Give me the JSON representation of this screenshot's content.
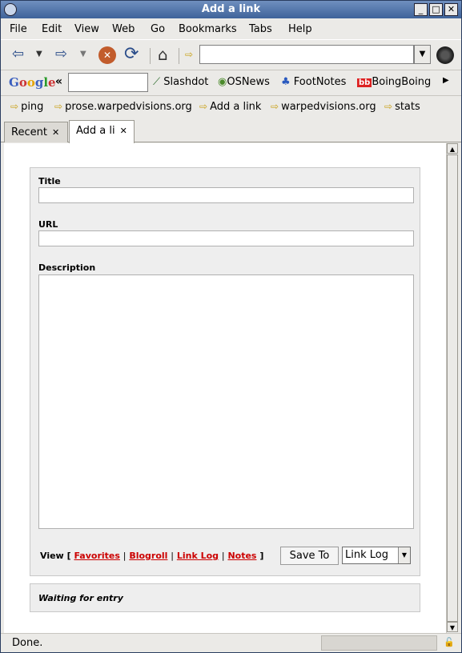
{
  "window": {
    "title": "Add a link"
  },
  "menu": [
    {
      "label": "File"
    },
    {
      "label": "Edit"
    },
    {
      "label": "View"
    },
    {
      "label": "Web"
    },
    {
      "label": "Go"
    },
    {
      "label": "Bookmarks"
    },
    {
      "label": "Tabs"
    },
    {
      "label": "Help"
    }
  ],
  "toolbar": {
    "url_value": ""
  },
  "search_bar": {
    "logo": "Google",
    "chevron": "«",
    "query": "",
    "bookmarks": [
      {
        "label": "Slashdot",
        "icon": "slashdot-icon"
      },
      {
        "label": "OSNews",
        "icon": "osnews-icon"
      },
      {
        "label": "FootNotes",
        "icon": "footnotes-icon"
      },
      {
        "label": "BoingBoing",
        "icon": "boingboing-icon",
        "badge": "bb"
      }
    ]
  },
  "bookmarks_bar": [
    {
      "label": "ping"
    },
    {
      "label": "prose.warpedvisions.org"
    },
    {
      "label": "Add a link"
    },
    {
      "label": "warpedvisions.org"
    },
    {
      "label": "stats"
    }
  ],
  "tabs": [
    {
      "label": "Recent",
      "active": false
    },
    {
      "label": "Add a li",
      "active": true
    }
  ],
  "form": {
    "title_label": "Title",
    "title_value": "",
    "url_label": "URL",
    "url_value": "",
    "description_label": "Description",
    "description_value": "",
    "view_label": "View",
    "bracket_open": "[",
    "bracket_close": "]",
    "separator": "|",
    "view_links": [
      "Favorites",
      "Blogroll",
      "Link Log",
      "Notes"
    ],
    "save_label": "Save To",
    "save_target": "Link Log"
  },
  "status_box": {
    "message": "Waiting for entry"
  },
  "statusbar": {
    "text": "Done."
  },
  "colors": {
    "link": "#cc0000",
    "titlebar": "#4f73a8"
  }
}
